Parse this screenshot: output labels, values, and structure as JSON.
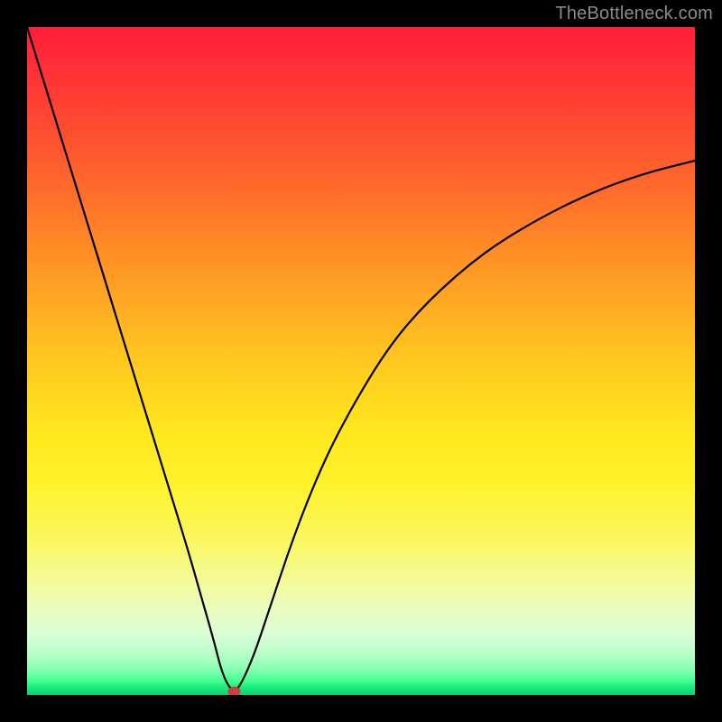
{
  "watermark": "TheBottleneck.com",
  "chart_data": {
    "type": "line",
    "title": "",
    "xlabel": "",
    "ylabel": "",
    "xlim": [
      0,
      100
    ],
    "ylim": [
      0,
      100
    ],
    "grid": false,
    "legend": false,
    "background_gradient": {
      "top_color": "#ff1f3a",
      "bottom_color": "#0fcf76",
      "description": "vertical red→orange→yellow→green gradient"
    },
    "series": [
      {
        "name": "bottleneck-curve",
        "color": "#000000",
        "x": [
          0,
          4,
          8,
          12,
          16,
          20,
          24,
          26,
          28,
          29,
          30,
          31,
          32,
          34,
          36,
          40,
          44,
          48,
          54,
          60,
          68,
          76,
          84,
          92,
          100
        ],
        "y": [
          100,
          87,
          74,
          61,
          48,
          35,
          22,
          15,
          8,
          4,
          1.5,
          0.5,
          1.5,
          6,
          12,
          24,
          34,
          42,
          52,
          59,
          66,
          71,
          75,
          78,
          80
        ]
      }
    ],
    "marker": {
      "name": "minimum-point",
      "x": 31,
      "y": 0.5,
      "color": "#cf3e3e"
    }
  }
}
